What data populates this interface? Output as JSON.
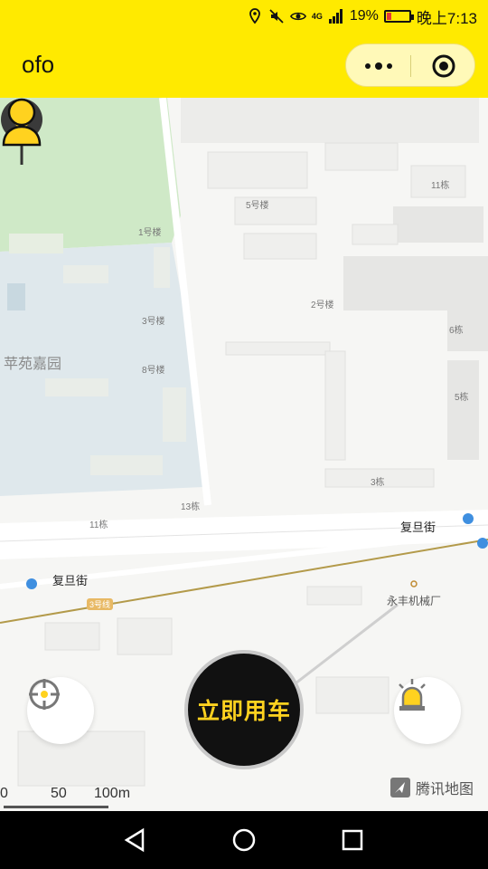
{
  "status_bar": {
    "battery_percent_text": "19%",
    "battery_level": 0.19,
    "time_text": "晚上7:13",
    "network_label": "4G",
    "icons": [
      "location-icon",
      "mute-icon",
      "eye-icon",
      "signal-icon",
      "battery-icon"
    ]
  },
  "header": {
    "title": "ofo",
    "more_icon": "more-dots-icon",
    "close_icon": "close-circle-icon"
  },
  "map": {
    "labels": {
      "community": "苹苑嘉园",
      "bldg_1": "1号楼",
      "bldg_3": "3号楼",
      "bldg_8": "8号楼",
      "bldg_5": "5号楼",
      "bldg_2": "2号楼",
      "bldg_11_top": "11栋",
      "bldg_6": "6栋",
      "bldg_5d": "5栋",
      "bldg_3d": "3栋",
      "bldg_13": "13栋",
      "bldg_11_mid": "11栋",
      "street_right": "复旦街",
      "street_left": "复旦街",
      "metro_line": "3号线",
      "poi": "永丰机械厂"
    },
    "scale": {
      "tick_0": "0",
      "tick_50": "50",
      "tick_100": "100m"
    },
    "provider": "腾讯地图"
  },
  "controls": {
    "ride_button": "立即用车",
    "locate_icon": "locate-target-icon",
    "alarm_icon": "alarm-light-icon",
    "user_icon": "user-icon"
  },
  "nav": {
    "back_icon": "back-triangle-icon",
    "home_icon": "home-circle-icon",
    "recents_icon": "recents-square-icon"
  },
  "colors": {
    "brand_yellow": "#ffea00",
    "ride_text": "#ffd21f",
    "pin_yellow": "#ffd21f",
    "dark": "#111111"
  }
}
